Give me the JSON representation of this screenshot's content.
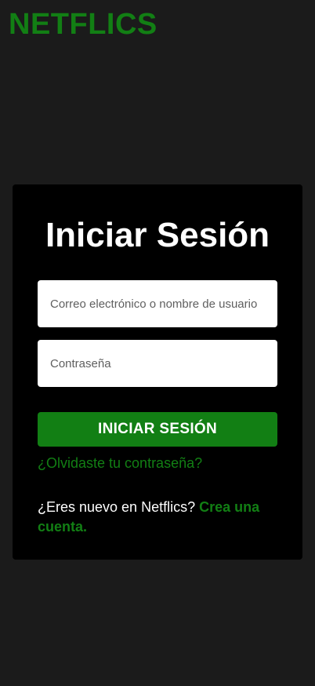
{
  "brand": {
    "logo_text": "NETFLICS",
    "accent_color": "#127f14"
  },
  "login": {
    "title": "Iniciar Sesión",
    "email_placeholder": "Correo electrónico o nombre de usuario",
    "email_value": "",
    "password_placeholder": "Contraseña",
    "password_value": "",
    "submit_label": "INICIAR SESIÓN",
    "forgot_link": "¿Olvidaste tu contraseña?",
    "signup_prompt": "¿Eres nuevo en Netflics?",
    "signup_link": "Crea una cuenta."
  },
  "colors": {
    "page_background": "#1b1b1b",
    "card_background": "#000000",
    "text": "#ffffff"
  }
}
